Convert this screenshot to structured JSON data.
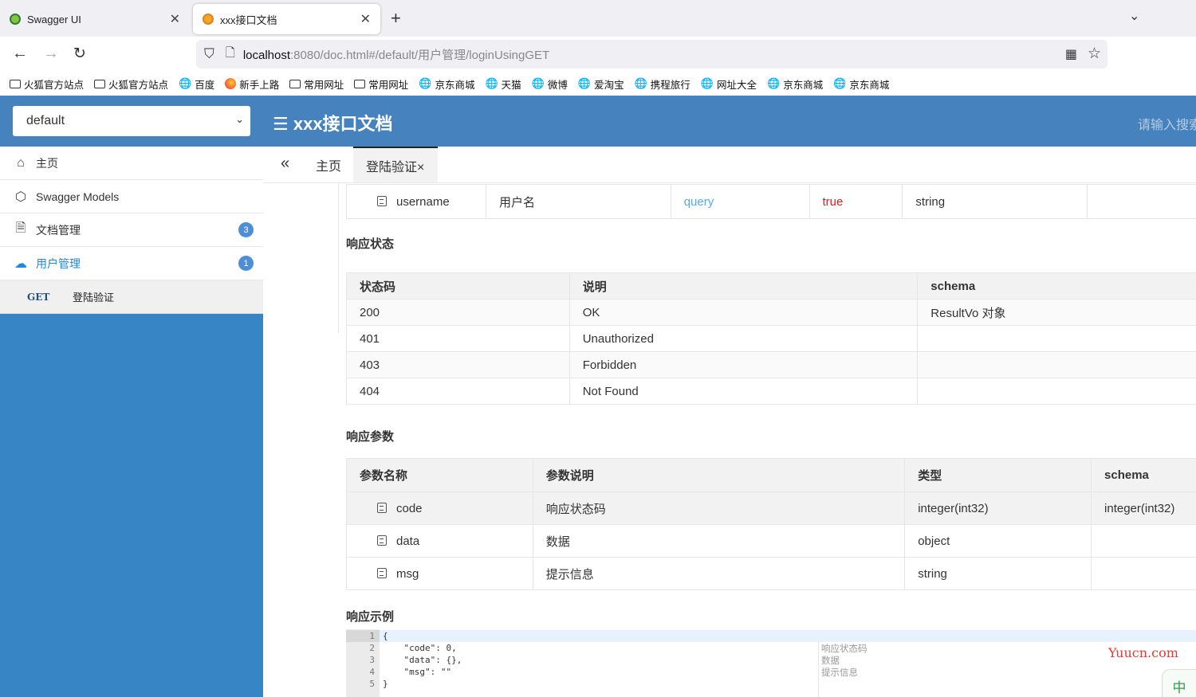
{
  "browser": {
    "tabs": [
      {
        "title": "Swagger UI",
        "active": false
      },
      {
        "title": "xxx接口文档",
        "active": true
      }
    ],
    "url_host": "localhost",
    "url_rest": ":8080/doc.html#/default/用户管理/loginUsingGET",
    "bookmarks": [
      {
        "label": "火狐官方站点",
        "icon": "folder-icon"
      },
      {
        "label": "火狐官方站点",
        "icon": "folder-icon"
      },
      {
        "label": "百度",
        "icon": "globe-icon"
      },
      {
        "label": "新手上路",
        "icon": "firefox-icon"
      },
      {
        "label": "常用网址",
        "icon": "folder-icon"
      },
      {
        "label": "常用网址",
        "icon": "folder-icon"
      },
      {
        "label": "京东商城",
        "icon": "globe-icon"
      },
      {
        "label": "天猫",
        "icon": "globe-icon"
      },
      {
        "label": "微博",
        "icon": "globe-icon"
      },
      {
        "label": "爱淘宝",
        "icon": "globe-icon"
      },
      {
        "label": "携程旅行",
        "icon": "globe-icon"
      },
      {
        "label": "网址大全",
        "icon": "globe-icon"
      },
      {
        "label": "京东商城",
        "icon": "globe-icon"
      },
      {
        "label": "京东商城",
        "icon": "globe-icon"
      }
    ]
  },
  "header": {
    "group": "default",
    "title": "xxx接口文档",
    "search_placeholder": "请输入搜索"
  },
  "sidebar": {
    "items": [
      {
        "label": "主页",
        "icon": "home-icon"
      },
      {
        "label": "Swagger Models",
        "icon": "cube-icon"
      },
      {
        "label": "文档管理",
        "icon": "document-icon",
        "badge": "3"
      },
      {
        "label": "用户管理",
        "icon": "cloud-icon",
        "badge": "1",
        "active": true
      }
    ],
    "sub_item": {
      "method": "GET",
      "label": "登陆验证"
    }
  },
  "content_tabs": {
    "home": "主页",
    "current": "登陆验证×"
  },
  "params_row": {
    "name": "username",
    "desc": "用户名",
    "in": "query",
    "required": "true",
    "type": "string"
  },
  "response_status": {
    "title": "响应状态",
    "headers": [
      "状态码",
      "说明",
      "schema"
    ],
    "rows": [
      [
        "200",
        "OK",
        "ResultVo 对象"
      ],
      [
        "401",
        "Unauthorized",
        ""
      ],
      [
        "403",
        "Forbidden",
        ""
      ],
      [
        "404",
        "Not Found",
        ""
      ]
    ]
  },
  "response_params": {
    "title": "响应参数",
    "headers": [
      "参数名称",
      "参数说明",
      "类型",
      "schema"
    ],
    "rows": [
      [
        "code",
        "响应状态码",
        "integer(int32)",
        "integer(int32)"
      ],
      [
        "data",
        "数据",
        "object",
        ""
      ],
      [
        "msg",
        "提示信息",
        "string",
        ""
      ]
    ]
  },
  "response_example": {
    "title": "响应示例",
    "line_numbers": [
      "1",
      "2",
      "3",
      "4",
      "5"
    ],
    "lines": [
      "{",
      "    \"code\": 0,",
      "    \"data\": {},",
      "    \"msg\": \"\"",
      "}"
    ],
    "comments": [
      "响应状态码",
      "数据",
      "提示信息"
    ]
  },
  "watermark": "Yuucn.com",
  "ime": "中",
  "colors": {
    "header_blue": "#4683be",
    "sidebar_blue": "#3785c4",
    "query": "#5aa6e8",
    "required_true": "#e02020"
  }
}
